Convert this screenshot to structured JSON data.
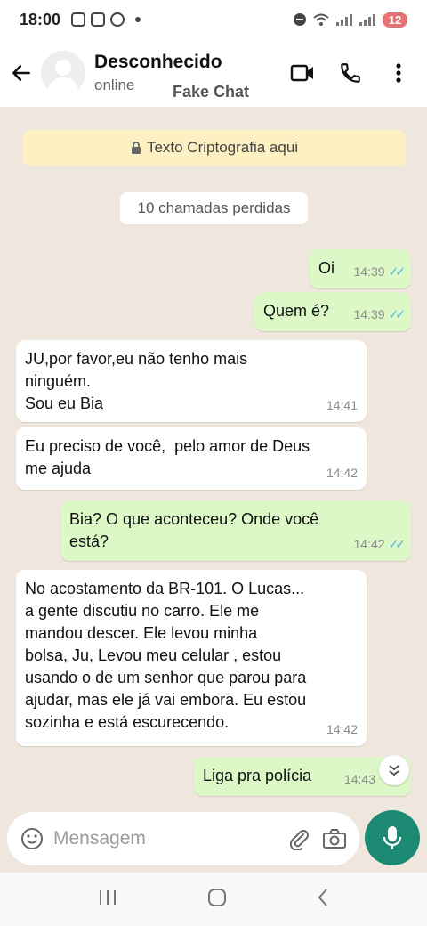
{
  "status_bar": {
    "time": "18:00",
    "battery": "12"
  },
  "header": {
    "contact_name": "Desconhecido",
    "contact_status": "online",
    "watermark": "Fake Chat",
    "icons": [
      "back-arrow-icon",
      "avatar",
      "video-call-icon",
      "phone-icon",
      "more-vert-icon"
    ]
  },
  "chat": {
    "encryption_notice": "Texto Criptografia aqui",
    "missed_calls": "10 chamadas perdidas",
    "messages": [
      {
        "dir": "out",
        "text": "Oi",
        "time": "14:39",
        "read": true
      },
      {
        "dir": "out",
        "text": "Quem é?",
        "time": "14:39",
        "read": true
      },
      {
        "dir": "in",
        "text": "JU,por favor,eu não tenho mais\nninguém.\nSou eu Bia",
        "time": "14:41"
      },
      {
        "dir": "in",
        "text": "Eu preciso de você,  pelo amor de Deus\nme ajuda",
        "time": "14:42"
      },
      {
        "dir": "out",
        "text": "Bia? O que aconteceu? Onde você\nestá?",
        "time": "14:42",
        "read": true
      },
      {
        "dir": "in",
        "text": "No acostamento da BR-101. O Lucas...\na gente discutiu no carro. Ele me\nmandou descer. Ele levou minha\nbolsa, Ju, Levou meu celular , estou\nusando o de um senhor que parou para\najudar, mas ele já vai embora. Eu estou\nsozinha e está escurecendo.",
        "time": "14:42"
      },
      {
        "dir": "out",
        "text": "Liga pra polícia",
        "time": "14:43",
        "read": false
      }
    ]
  },
  "composer": {
    "placeholder": "Mensagem"
  },
  "colors": {
    "chat_bg": "#efe7de",
    "outgoing_bubble": "#dcf8c6",
    "incoming_bubble": "#ffffff",
    "accent": "#1c8a73",
    "read_ticks": "#4fb6ec",
    "banner": "#fdf1c3"
  }
}
